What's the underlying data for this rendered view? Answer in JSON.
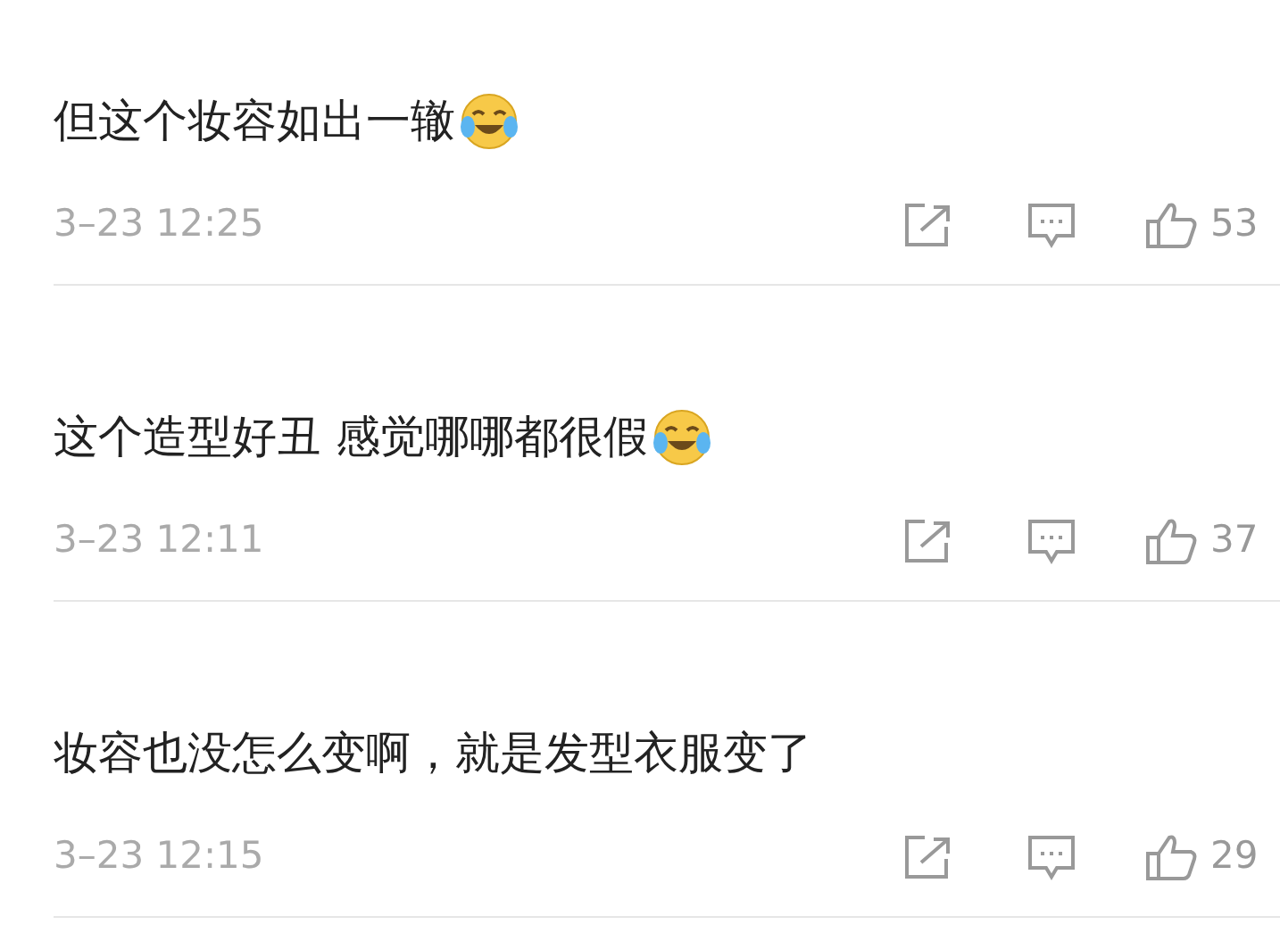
{
  "comments": [
    {
      "text": "但这个妆容如出一辙",
      "emoji": true,
      "time": "3–23 12:25",
      "likes": "53"
    },
    {
      "text": "这个造型好丑 感觉哪哪都很假",
      "emoji": true,
      "time": "3–23 12:11",
      "likes": "37"
    },
    {
      "text": "妆容也没怎么变啊，就是发型衣服变了",
      "emoji": false,
      "time": "3–23 12:15",
      "likes": "29"
    }
  ]
}
